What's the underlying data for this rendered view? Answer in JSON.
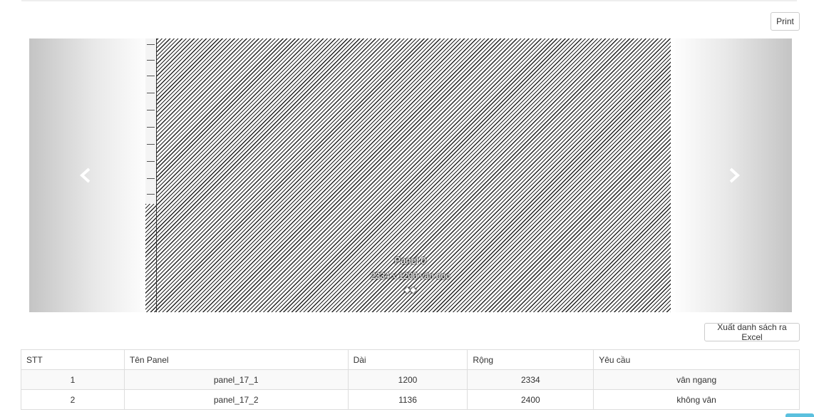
{
  "toolbar": {
    "print_label": "Print",
    "export_label": "Xuất danh sách ra Excel"
  },
  "carousel": {
    "prev_icon": "chevron-left-icon",
    "next_icon": "chevron-right-icon",
    "slide": {
      "title": "Panel 0",
      "subtitle": "2334 x 1200 vân dọc",
      "glyph": "◆◆"
    }
  },
  "table": {
    "headers": [
      "STT",
      "Tên Panel",
      "Dài",
      "Rộng",
      "Yêu cầu"
    ],
    "rows": [
      [
        "1",
        "panel_17_1",
        "1200",
        "2334",
        "vân ngang"
      ],
      [
        "2",
        "panel_17_2",
        "1136",
        "2400",
        "không vân"
      ]
    ]
  },
  "colors": {
    "accent": "#5bc0de",
    "border": "#dddddd",
    "text": "#333333"
  }
}
